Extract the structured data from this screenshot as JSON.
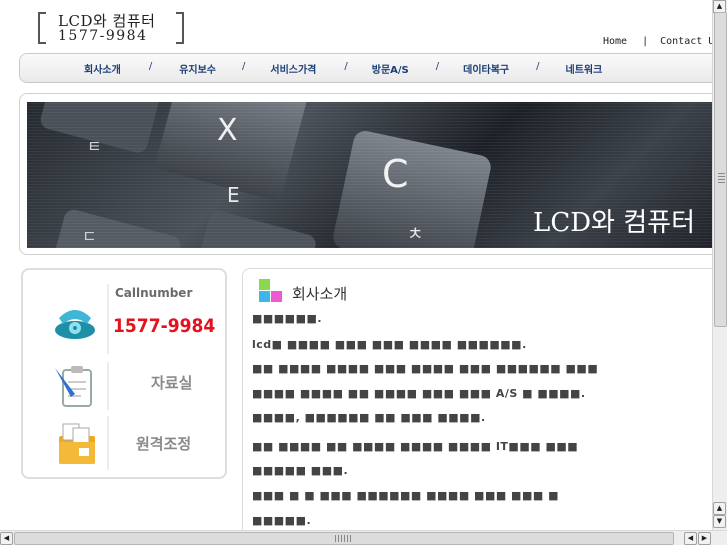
{
  "header": {
    "logo_line1": "LCD와 컴퓨터",
    "logo_line2": "1577-9984",
    "links": {
      "home": "Home",
      "separator": "|",
      "contact": "Contact Us"
    }
  },
  "nav": {
    "items": [
      "회사소개",
      "유지보수",
      "서비스가격",
      "방문A/S",
      "데이타복구",
      "네트워크"
    ],
    "separator": "/"
  },
  "banner": {
    "title": "LCD와 컴퓨터",
    "key_letters": [
      "X",
      "E",
      "C",
      "ㅊ",
      "ㅌ",
      "ㄷ"
    ]
  },
  "sidebar": {
    "call_title": "Callnumber",
    "call_number": "1577-9984",
    "archive_label": "자료실",
    "remote_label": "원격조정"
  },
  "content": {
    "title": "회사소개",
    "lines": [
      "■■■■■■.",
      "lcd■ ■■■■ ■■■ ■■■ ■■■■ ■■■■■■.",
      "■■ ■■■■ ■■■■ ■■■ ■■■■ ■■■ ■■■■■■ ■■■",
      "■■■■ ■■■■ ■■ ■■■■ ■■■ ■■■ A/S ■ ■■■■.",
      "■■■■, ■■■■■■ ■■ ■■■ ■■■■.",
      "■■ ■■■■ ■■ ■■■■ ■■■■ ■■■■ IT■■■ ■■■",
      "■■■■■ ■■■.",
      "■■■ ■ ■ ■■■ ■■■■■■ ■■■■ ■■■ ■■■ ■",
      "■■■■■."
    ]
  },
  "colors": {
    "nav_text": "#1d3f78",
    "call_number": "#e3121e",
    "icon_green": "#8ad84b",
    "icon_blue": "#3fb6ea",
    "icon_pink": "#ee5ad0"
  },
  "icons": [
    "phone-icon",
    "clipboard-icon",
    "remote-folder-icon",
    "section-squares-icon"
  ]
}
